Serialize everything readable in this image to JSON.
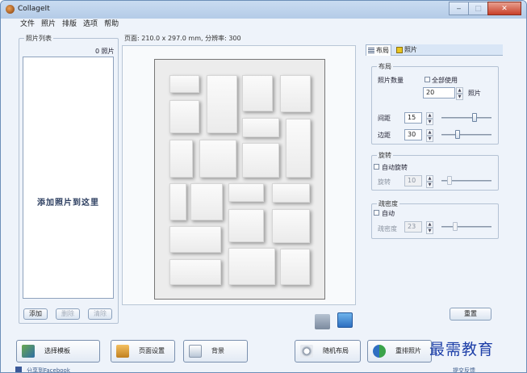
{
  "window": {
    "title": "CollageIt"
  },
  "menu": [
    "文件",
    "照片",
    "排版",
    "选项",
    "帮助"
  ],
  "left_panel": {
    "title": "照片列表",
    "count": "0 照片",
    "placeholder": "添加照片到这里",
    "buttons": {
      "add": "添加",
      "delete": "删除",
      "clear": "清除"
    }
  },
  "canvas": {
    "page_info": "页面: 210.0 x 297.0 mm, 分辨率: 300"
  },
  "tabs": {
    "layout": "布局",
    "photo": "照片"
  },
  "layout_group": {
    "title": "布局",
    "photo_count_label": "照片数量",
    "use_all_label": "全部使用",
    "photo_count_value": "20",
    "photo_unit": "照片",
    "spacing_label": "间距",
    "spacing_value": "15",
    "margin_label": "边距",
    "margin_value": "30"
  },
  "rotation_group": {
    "title": "旋转",
    "auto_label": "自动旋转",
    "rotate_label": "旋转",
    "rotate_value": "10"
  },
  "density_group": {
    "title": "疏密度",
    "auto_label": "自动",
    "density_label": "疏密度",
    "density_value": "23"
  },
  "reset_button": "重置",
  "bottom": {
    "choose_template": "选择模板",
    "page_setup": "页面设置",
    "background": "背景",
    "random_layout": "随机布局",
    "rearrange_photos": "重排照片"
  },
  "status": {
    "share": "分享到Facebook",
    "feedback": "提交反馈"
  },
  "watermark": "最需教育"
}
